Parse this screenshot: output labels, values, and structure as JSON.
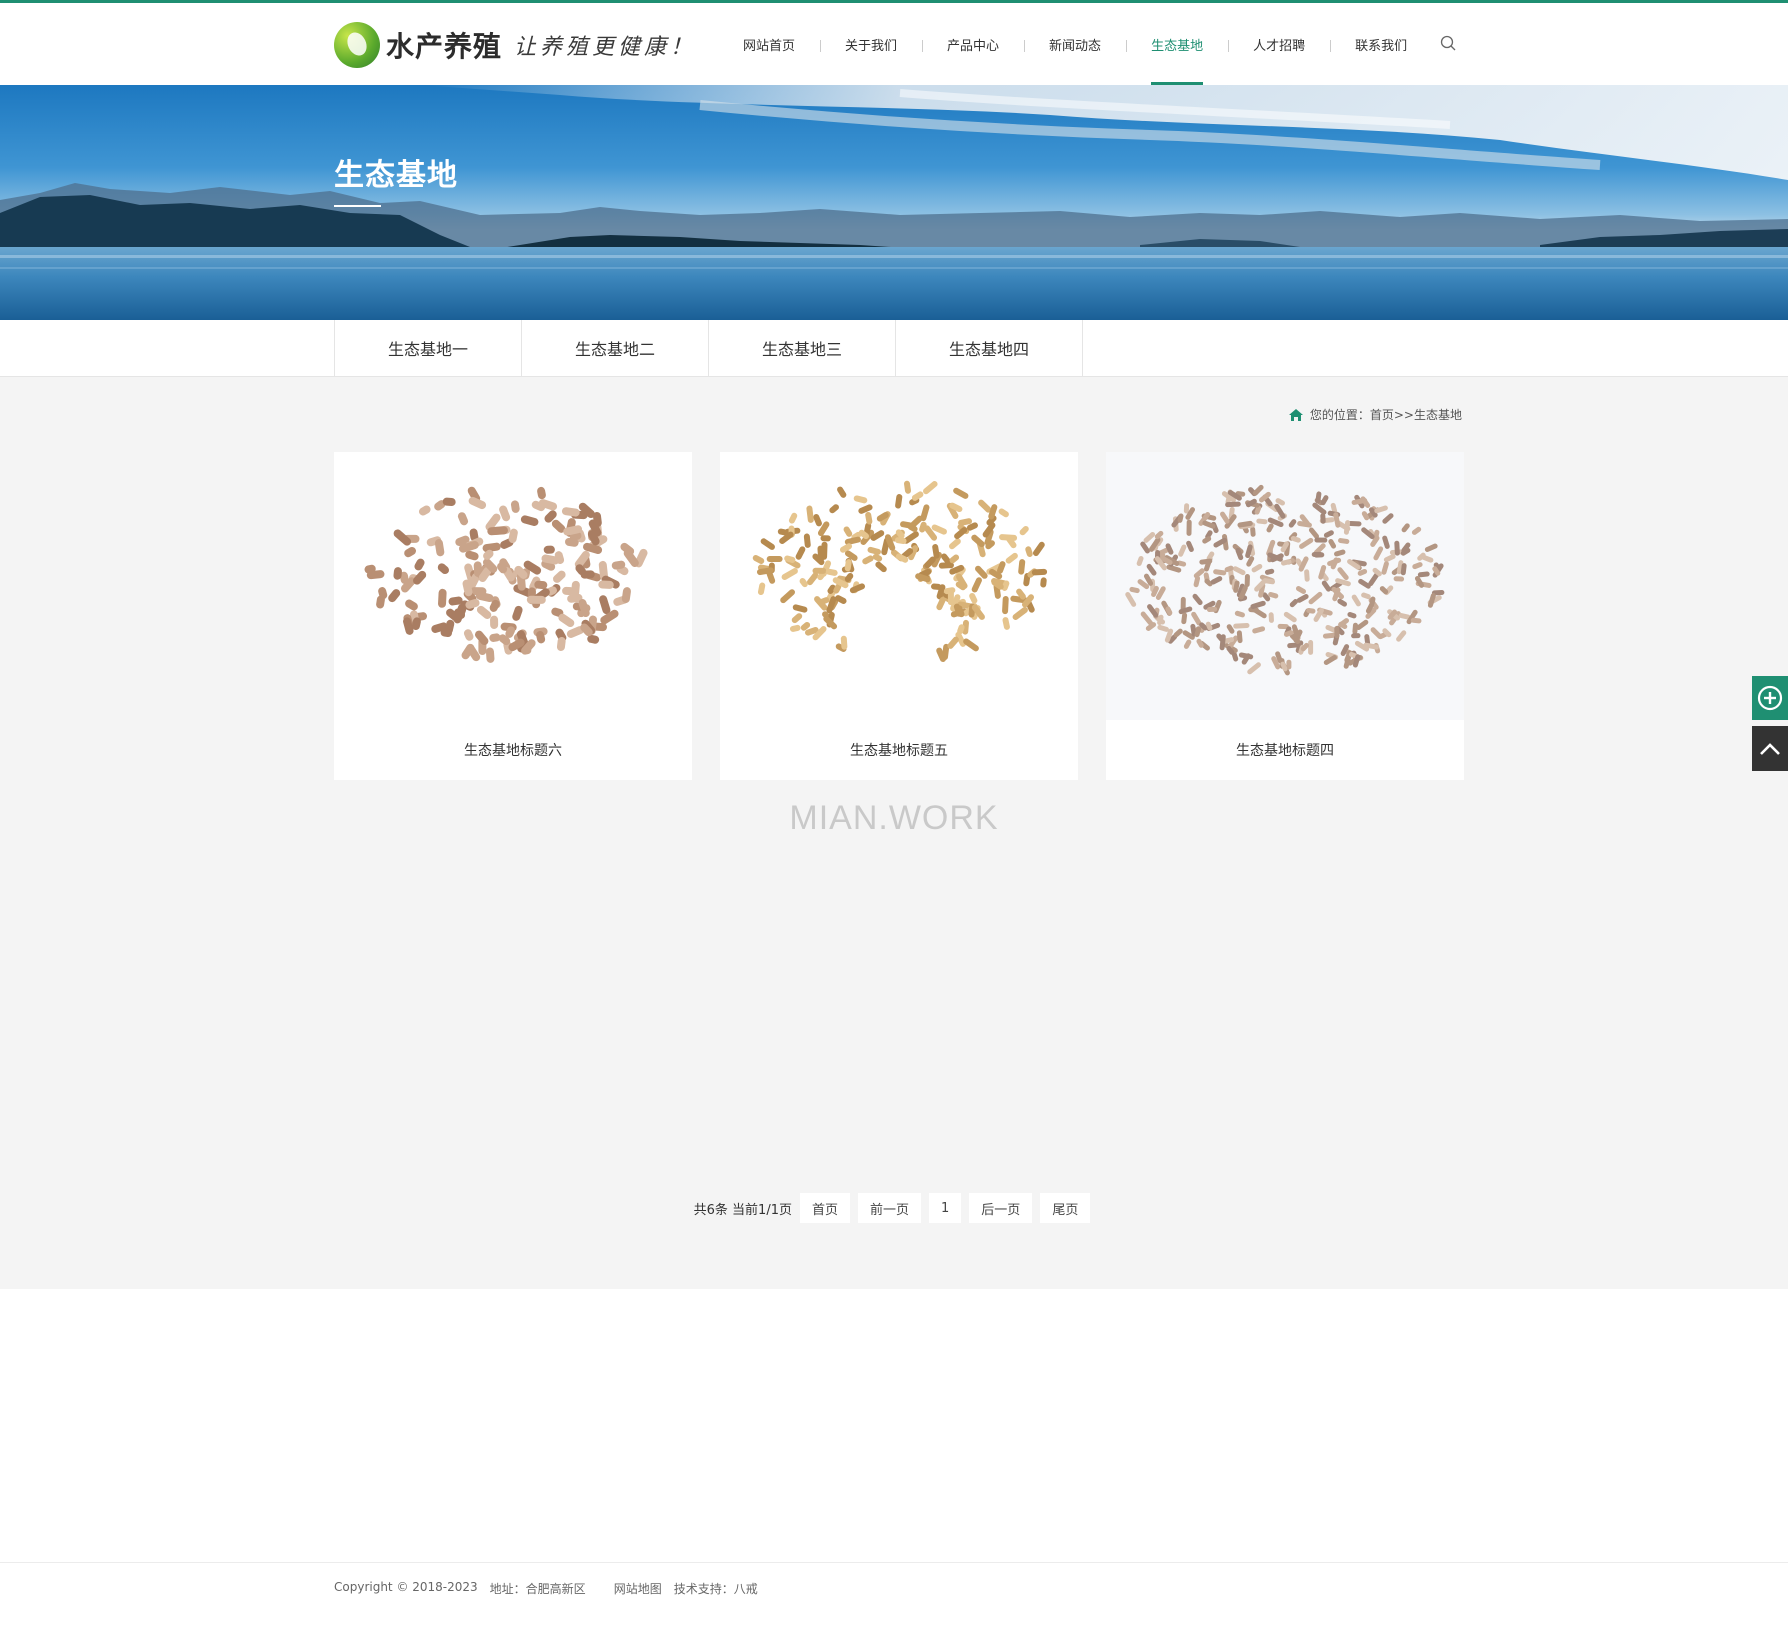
{
  "header": {
    "logo_name": "水产养殖",
    "logo_slogan": "让养殖更健康！",
    "nav": [
      {
        "label": "网站首页"
      },
      {
        "label": "关于我们"
      },
      {
        "label": "产品中心"
      },
      {
        "label": "新闻动态"
      },
      {
        "label": "生态基地",
        "active": true
      },
      {
        "label": "人才招聘"
      },
      {
        "label": "联系我们"
      }
    ],
    "accent_color": "#1f8f72"
  },
  "banner": {
    "title": "生态基地"
  },
  "subnav": {
    "tabs": [
      "生态基地一",
      "生态基地二",
      "生态基地三",
      "生态基地四"
    ]
  },
  "breadcrumb": {
    "prefix": "您的位置：",
    "home": "首页",
    "separator": ">>",
    "current": "生态基地"
  },
  "cards": [
    {
      "title": "生态基地标题六"
    },
    {
      "title": "生态基地标题五"
    },
    {
      "title": "生态基地标题四"
    }
  ],
  "watermark": "MIAN.WORK",
  "pager": {
    "info": "共6条 当前1/1页",
    "first": "首页",
    "prev": "前一页",
    "page": "1",
    "next": "后一页",
    "last": "尾页"
  },
  "footer": {
    "copyright": "Copyright © 2018-2023",
    "address": "地址：合肥高新区",
    "sitemap": "网站地图",
    "support": "技术支持：八戒"
  }
}
